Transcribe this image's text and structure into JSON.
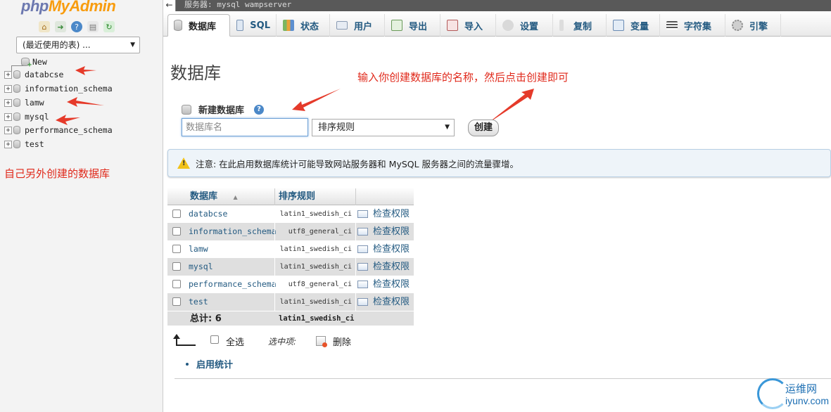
{
  "logo": {
    "part1": "php",
    "part2": "MyAdmin"
  },
  "nav": {
    "recent_select": "(最近使用的表) ...",
    "new_label": "New",
    "databases": [
      "databcse",
      "information_schema",
      "lamw",
      "mysql",
      "performance_schema",
      "test"
    ],
    "annotation": "自己另外创建的数据库"
  },
  "topbar": {
    "back": "←",
    "server": "服务器: mysql wampserver"
  },
  "tabs": [
    "数据库",
    "SQL",
    "状态",
    "用户",
    "导出",
    "导入",
    "设置",
    "复制",
    "变量",
    "字符集",
    "引擎"
  ],
  "main": {
    "title": "数据库",
    "annotation": "输入你创建数据库的名称，然后点击创建即可",
    "create_label": "新建数据库",
    "help_icon": "?",
    "db_name_placeholder": "数据库名",
    "collation_value": "排序规则",
    "create_button": "创建",
    "notice": "注意: 在此启用数据库统计可能导致网站服务器和 MySQL 服务器之间的流量骤增。"
  },
  "table": {
    "headers": {
      "database": "数据库",
      "sort_glyph": "▲",
      "collation": "排序规则"
    },
    "rows": [
      {
        "name": "databcse",
        "collation": "latin1_swedish_ci",
        "action": "检查权限"
      },
      {
        "name": "information_schema",
        "collation": "utf8_general_ci",
        "action": "检查权限"
      },
      {
        "name": "lamw",
        "collation": "latin1_swedish_ci",
        "action": "检查权限"
      },
      {
        "name": "mysql",
        "collation": "latin1_swedish_ci",
        "action": "检查权限"
      },
      {
        "name": "performance_schema",
        "collation": "utf8_general_ci",
        "action": "检查权限"
      },
      {
        "name": "test",
        "collation": "latin1_swedish_ci",
        "action": "检查权限"
      }
    ],
    "total_label": "总计: 6",
    "total_collation": "latin1_swedish_ci"
  },
  "bulk": {
    "select_all": "全选",
    "selected": "选中项:",
    "delete": "删除"
  },
  "stats_link": "启用统计",
  "watermark": {
    "cn": "运维网",
    "en": "iyunv.com"
  },
  "colors": {
    "annotation": "#e0291b",
    "link": "#235a81",
    "logo_php": "#6c78af",
    "logo_admin": "#f89c0e"
  }
}
